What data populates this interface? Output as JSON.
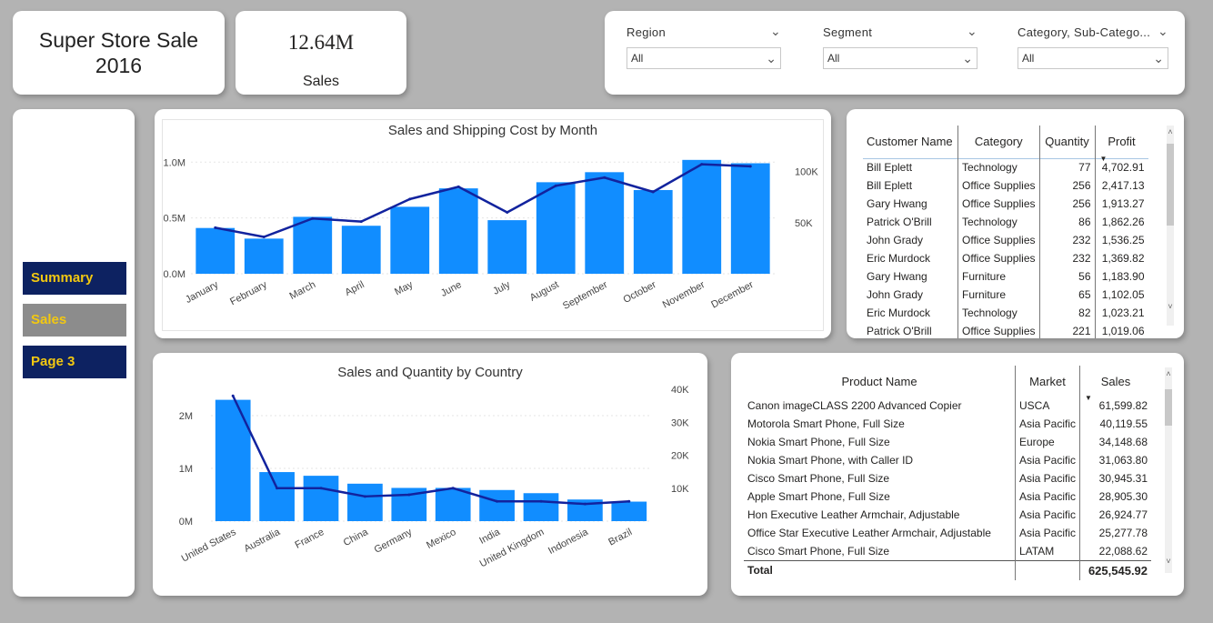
{
  "title_card": {
    "title": "Super Store Sale\n2016"
  },
  "kpi": {
    "value": "12.64M",
    "label": "Sales"
  },
  "slicers": [
    {
      "label": "Region",
      "value": "All"
    },
    {
      "label": "Segment",
      "value": "All"
    },
    {
      "label": "Category, Sub-Catego...",
      "value": "All"
    }
  ],
  "nav": {
    "summary": "Summary",
    "sales": "Sales",
    "page3": "Page 3"
  },
  "chart_data": [
    {
      "type": "bar",
      "title": "Sales and Shipping Cost by Month",
      "categories": [
        "January",
        "February",
        "March",
        "April",
        "May",
        "June",
        "July",
        "August",
        "September",
        "October",
        "November",
        "December"
      ],
      "series": [
        {
          "values": [
            410000,
            315000,
            510000,
            430000,
            600000,
            765000,
            480000,
            820000,
            910000,
            750000,
            1020000,
            990000
          ],
          "color": "#118dff"
        },
        {
          "values": [
            45000,
            36000,
            54000,
            51000,
            73000,
            85000,
            60000,
            86000,
            94000,
            80000,
            107000,
            105000
          ],
          "color": "#12239e"
        }
      ],
      "y_ticks": [
        "1.0M",
        "0.5M",
        "0.0M"
      ],
      "y2_ticks": [
        "100K",
        "50K"
      ],
      "ylim": [
        0,
        1100000
      ],
      "y2lim": [
        0,
        120000
      ]
    },
    {
      "type": "bar",
      "title": "Sales and Quantity by Country",
      "categories": [
        "United States",
        "Australia",
        "France",
        "China",
        "Germany",
        "Mexico",
        "India",
        "United Kingdom",
        "Indonesia",
        "Brazil"
      ],
      "series": [
        {
          "values": [
            2300000,
            930000,
            860000,
            710000,
            630000,
            630000,
            590000,
            530000,
            410000,
            370000
          ],
          "color": "#118dff"
        },
        {
          "values": [
            38000,
            10000,
            10000,
            7500,
            8000,
            10000,
            6000,
            6000,
            5200,
            6000
          ],
          "color": "#12239e"
        }
      ],
      "y_ticks": [
        "2M",
        "1M",
        "0M"
      ],
      "y2_ticks": [
        "40K",
        "30K",
        "20K",
        "10K"
      ],
      "ylim": [
        0,
        2500000
      ],
      "y2lim": [
        0,
        40000
      ]
    }
  ],
  "customer_table": {
    "headers": [
      "Customer Name",
      "Category",
      "Quantity",
      "Profit"
    ],
    "rows": [
      [
        "Bill Eplett",
        "Technology",
        "77",
        "4,702.91"
      ],
      [
        "Bill Eplett",
        "Office Supplies",
        "256",
        "2,417.13"
      ],
      [
        "Gary Hwang",
        "Office Supplies",
        "256",
        "1,913.27"
      ],
      [
        "Patrick O'Brill",
        "Technology",
        "86",
        "1,862.26"
      ],
      [
        "John Grady",
        "Office Supplies",
        "232",
        "1,536.25"
      ],
      [
        "Eric Murdock",
        "Office Supplies",
        "232",
        "1,369.82"
      ],
      [
        "Gary Hwang",
        "Furniture",
        "56",
        "1,183.90"
      ],
      [
        "John Grady",
        "Furniture",
        "65",
        "1,102.05"
      ],
      [
        "Eric Murdock",
        "Technology",
        "82",
        "1,023.21"
      ],
      [
        "Patrick O'Brill",
        "Office Supplies",
        "221",
        "1,019.06"
      ]
    ]
  },
  "product_table": {
    "headers": [
      "Product Name",
      "Market",
      "Sales"
    ],
    "rows": [
      [
        "Canon imageCLASS 2200 Advanced Copier",
        "USCA",
        "61,599.82"
      ],
      [
        "Motorola Smart Phone, Full Size",
        "Asia Pacific",
        "40,119.55"
      ],
      [
        "Nokia Smart Phone, Full Size",
        "Europe",
        "34,148.68"
      ],
      [
        "Nokia Smart Phone, with Caller ID",
        "Asia Pacific",
        "31,063.80"
      ],
      [
        "Cisco Smart Phone, Full Size",
        "Asia Pacific",
        "30,945.31"
      ],
      [
        "Apple Smart Phone, Full Size",
        "Asia Pacific",
        "28,905.30"
      ],
      [
        "Hon Executive Leather Armchair, Adjustable",
        "Asia Pacific",
        "26,924.77"
      ],
      [
        "Office Star Executive Leather Armchair, Adjustable",
        "Asia Pacific",
        "25,277.78"
      ],
      [
        "Cisco Smart Phone, Full Size",
        "LATAM",
        "22,088.62"
      ]
    ],
    "total_label": "Total",
    "total_value": "625,545.92"
  }
}
